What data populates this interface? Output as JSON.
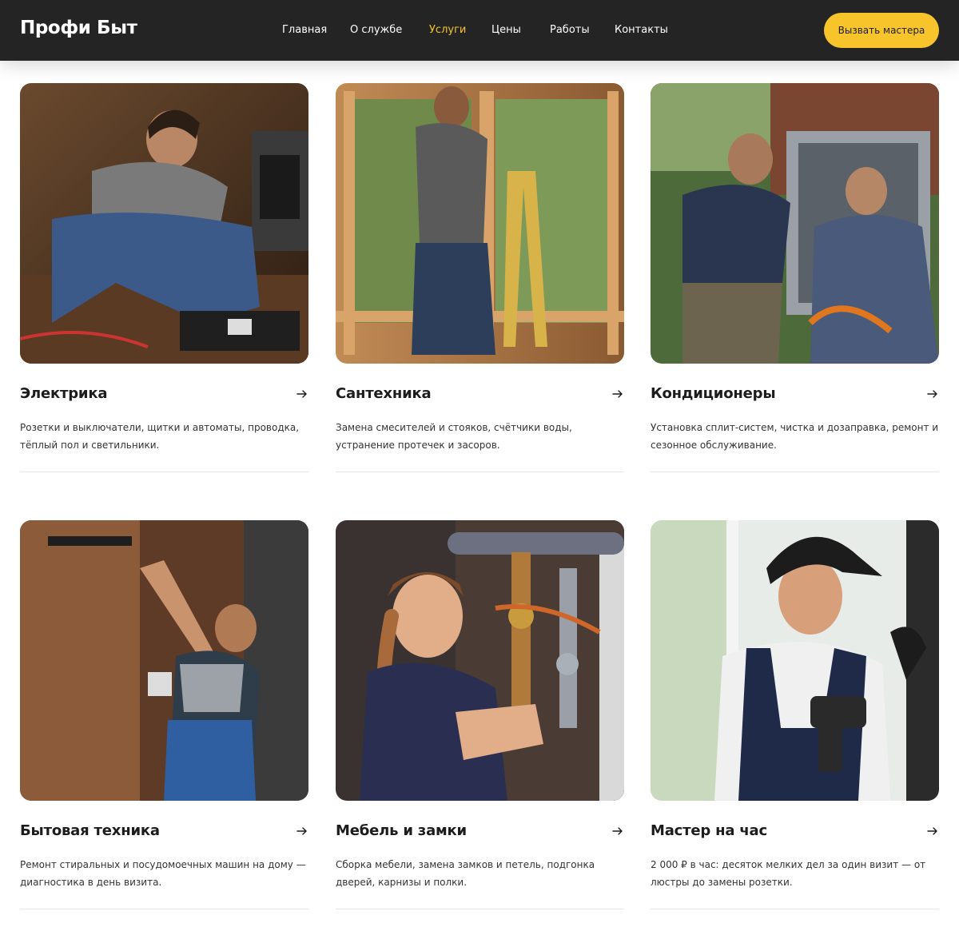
{
  "header": {
    "logo": "Профи Быт",
    "nav": [
      {
        "label": "Главная",
        "active": false
      },
      {
        "label": "О службе",
        "active": false
      },
      {
        "label": "Услуги",
        "active": true
      },
      {
        "label": "Цены",
        "active": false
      },
      {
        "label": "Работы",
        "active": false
      },
      {
        "label": "Контакты",
        "active": false
      }
    ],
    "cta_label": "Вызвать мастера"
  },
  "colors": {
    "header_bg": "#242424",
    "accent": "#f7c52b",
    "text": "#1c1c1c",
    "divider": "#e6e6e6"
  },
  "services": [
    {
      "title": "Электрика",
      "description": "Розетки и выключатели, щитки и автоматы, проводка, тёплый пол и светильники.",
      "arrow_icon": "arrow-right-icon"
    },
    {
      "title": "Сантехника",
      "description": "Замена смесителей и стояков, счётчики воды, устранение протечек и засоров.",
      "arrow_icon": "arrow-right-icon"
    },
    {
      "title": "Кондиционеры",
      "description": "Установка сплит-систем, чистка и дозаправка, ремонт и сезонное обслуживание.",
      "arrow_icon": "arrow-right-icon"
    },
    {
      "title": "Бытовая техника",
      "description": "Ремонт стиральных и посудомоечных машин на дому — диагностика в день визита.",
      "arrow_icon": "arrow-right-icon"
    },
    {
      "title": "Мебель и замки",
      "description": "Сборка мебели, замена замков и петель, подгонка дверей, карнизы и полки.",
      "arrow_icon": "arrow-right-icon"
    },
    {
      "title": "Мастер на час",
      "description": "2 000 ₽ в час: десяток мелких дел за один визит — от люстры до замены розетки.",
      "arrow_icon": "arrow-right-icon"
    }
  ]
}
